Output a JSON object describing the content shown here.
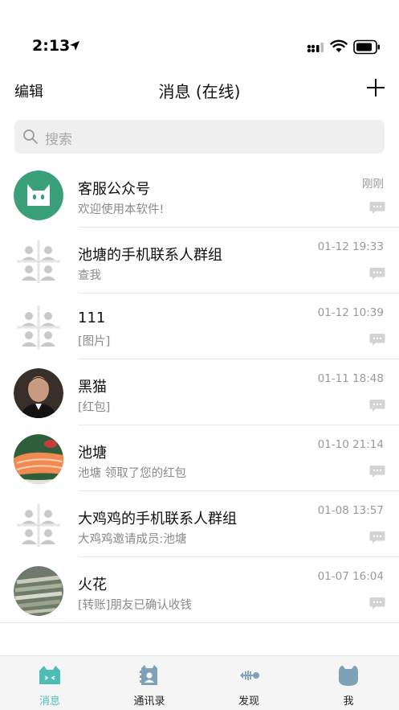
{
  "status_bar": {
    "time": "2:13"
  },
  "nav": {
    "edit_label": "编辑",
    "title": "消息 (在线)"
  },
  "search": {
    "placeholder": "搜索"
  },
  "conversations": [
    {
      "name": "客服公众号",
      "preview": "欢迎使用本软件!",
      "time": "刚刚",
      "avatar": "cat-logo-avatar"
    },
    {
      "name": "池塘的手机联系人群组",
      "preview": "查我",
      "time": "01-12 19:33",
      "avatar": "group-avatar"
    },
    {
      "name": "111",
      "preview": "[图片]",
      "time": "01-12 10:39",
      "avatar": "group-avatar"
    },
    {
      "name": "黑猫",
      "preview": "[红包]",
      "time": "01-11 18:48",
      "avatar": "person-photo-avatar"
    },
    {
      "name": "池塘",
      "preview": "池塘 领取了您的红包",
      "time": "01-10 21:14",
      "avatar": "salmon-photo-avatar"
    },
    {
      "name": "大鸡鸡的手机联系人群组",
      "preview": "大鸡鸡邀请成员:池塘",
      "time": "01-08 13:57",
      "avatar": "group-avatar"
    },
    {
      "name": "火花",
      "preview": "[转账]朋友已确认收钱",
      "time": "01-07 16:04",
      "avatar": "fish-photo-avatar"
    }
  ],
  "tabs": [
    {
      "label": "消息",
      "icon": "cat-icon",
      "active": true
    },
    {
      "label": "通讯录",
      "icon": "contacts-icon",
      "active": false
    },
    {
      "label": "发现",
      "icon": "fishbone-icon",
      "active": false
    },
    {
      "label": "我",
      "icon": "profile-icon",
      "active": false
    }
  ],
  "colors": {
    "accent": "#4dbdb5",
    "official_avatar_bg": "#3aa07a"
  }
}
